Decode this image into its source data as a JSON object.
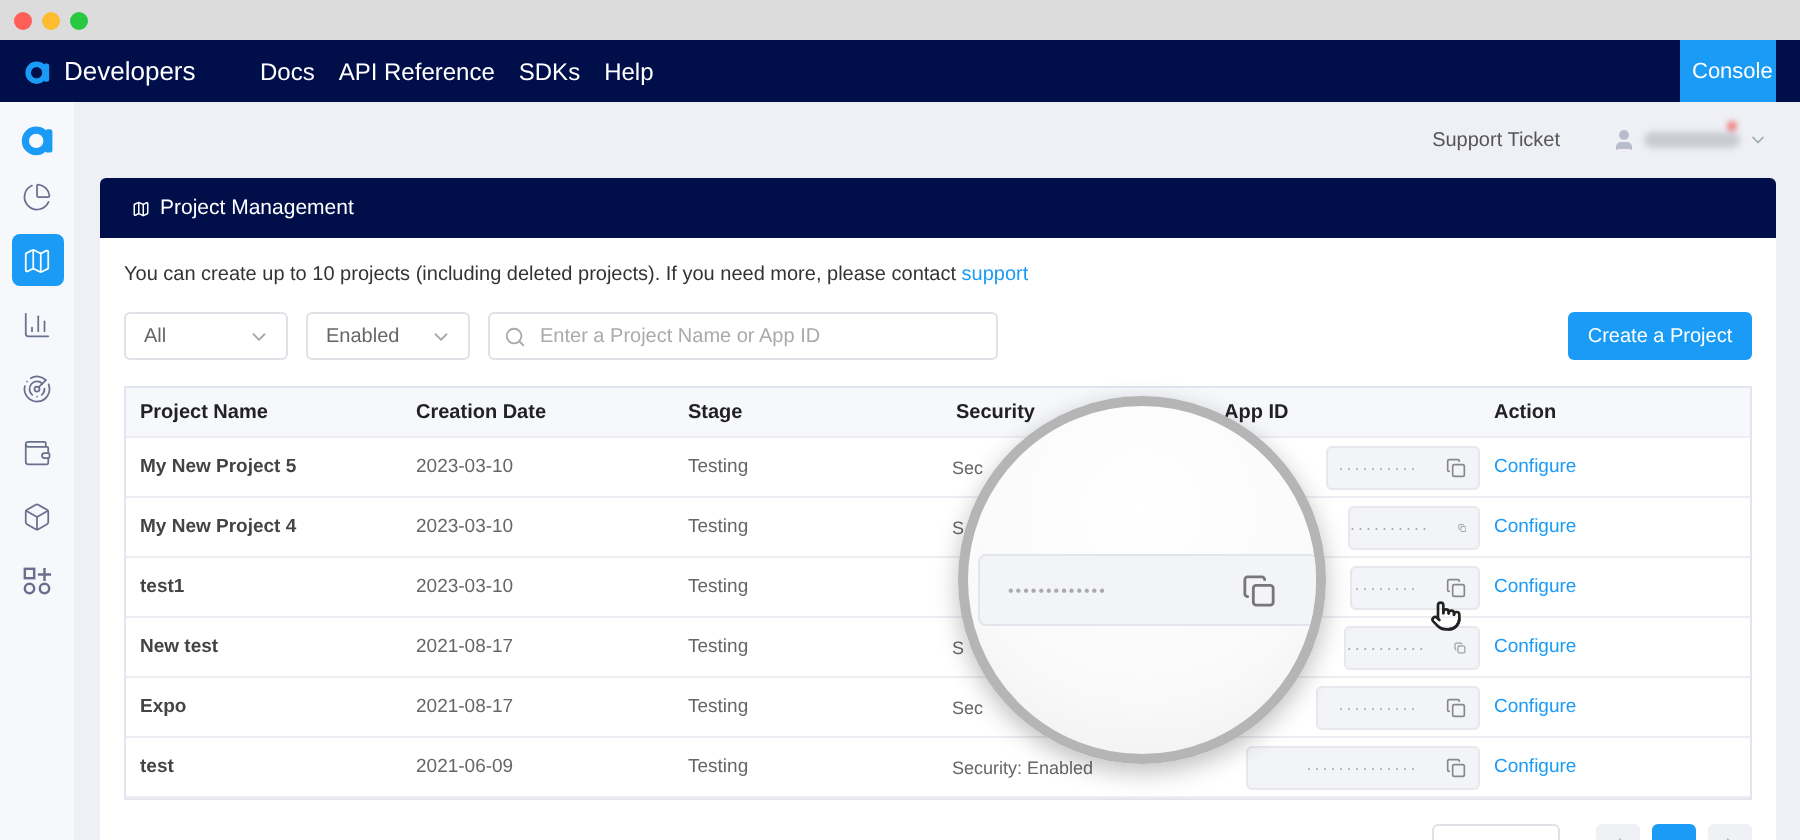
{
  "nav": {
    "brand": "Developers",
    "links": [
      "Docs",
      "API Reference",
      "SDKs",
      "Help"
    ],
    "console": "Console"
  },
  "sidebar": {
    "items": [
      {
        "selected": false
      },
      {
        "selected": true
      },
      {
        "selected": false
      },
      {
        "selected": false
      },
      {
        "selected": false
      },
      {
        "selected": false
      },
      {
        "selected": false
      }
    ]
  },
  "header": {
    "support": "Support Ticket",
    "notification": true
  },
  "card": {
    "title": "Project Management",
    "notice": "You can create up to 10 projects (including deleted projects). If you need more, please contact ",
    "notice_link": "support"
  },
  "filters": {
    "type": "All",
    "status": "Enabled",
    "search_placeholder": "Enter a Project Name or App ID",
    "create": "Create a Project"
  },
  "table": {
    "columns": [
      "Project Name",
      "Creation Date",
      "Stage",
      "Security",
      "App ID",
      "Action"
    ],
    "rows": [
      {
        "name": "My New Project 5",
        "date": "2023-03-10",
        "stage": "Testing",
        "security": "Sec",
        "app_id": "··········",
        "action": "Configure"
      },
      {
        "name": "My New Project 4",
        "date": "2023-03-10",
        "stage": "Testing",
        "security": "S",
        "app_id": "··········",
        "action": "Configure"
      },
      {
        "name": "test1",
        "date": "2023-03-10",
        "stage": "Testing",
        "app_id": "········",
        "action": "Configure"
      },
      {
        "name": "New test",
        "date": "2021-08-17",
        "stage": "Testing",
        "security": "S",
        "app_id": "··········",
        "action": "Configure"
      },
      {
        "name": "Expo",
        "date": "2021-08-17",
        "stage": "Testing",
        "security": "Sec",
        "app_id": "··········",
        "action": "Configure"
      },
      {
        "name": "test",
        "date": "2021-06-09",
        "stage": "Testing",
        "security": "Security: Enabled",
        "app_id": "··············",
        "action": "Configure"
      }
    ]
  },
  "magnifier": {
    "app_id": "•••••••••••••"
  },
  "pagination": {
    "pages": [
      {
        "selected": true
      }
    ]
  }
}
